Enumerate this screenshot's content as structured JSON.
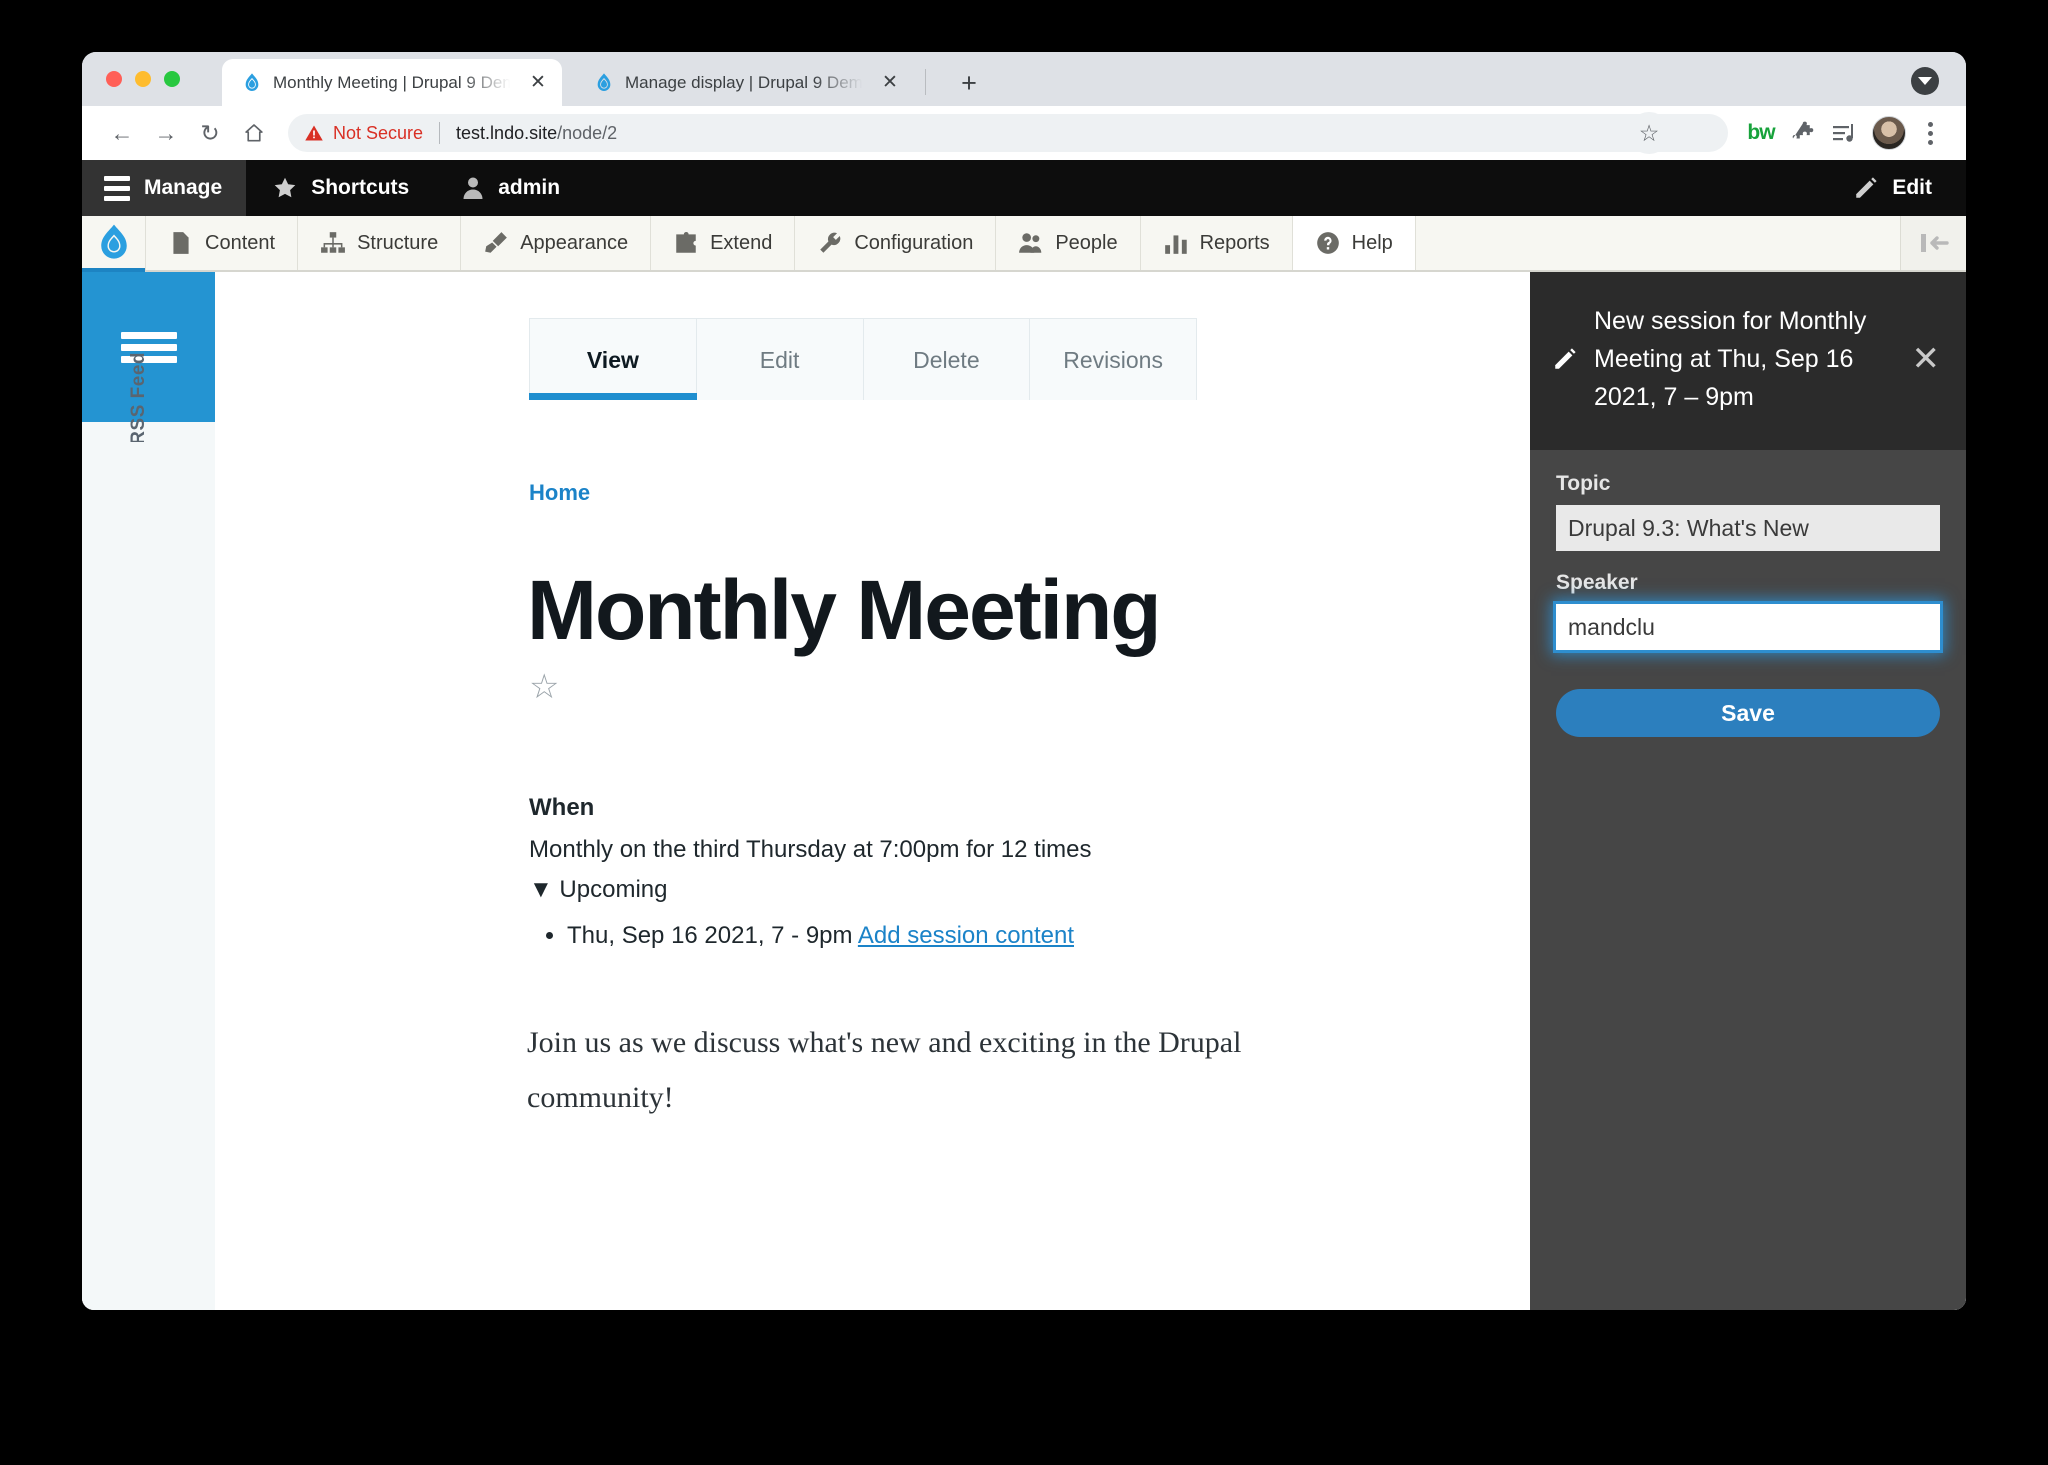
{
  "browser": {
    "tabs": [
      {
        "title": "Monthly Meeting | Drupal 9 Dem",
        "icon": "drupal-drop-icon",
        "active": true,
        "close_label": "✕"
      },
      {
        "title": "Manage display | Drupal 9 Dem",
        "icon": "drupal-drop-icon",
        "active": false,
        "close_label": "✕"
      }
    ],
    "new_tab_label": "+",
    "nav": {
      "back": "←",
      "forward": "→",
      "reload": "↻",
      "home": "⌂"
    },
    "omnibox": {
      "security_label": "Not Secure",
      "security_icon": "warning-triangle-icon",
      "url_host": "test.lndo.site",
      "url_path": "/node/2"
    },
    "extensions": [
      {
        "name": "bookmark-star-icon",
        "label": "☆"
      },
      {
        "name": "bw-extension-icon",
        "label": "bw"
      },
      {
        "name": "puzzle-extensions-icon",
        "label": ""
      },
      {
        "name": "media-playlist-icon",
        "label": ""
      }
    ],
    "menu_label": "⋮"
  },
  "admin_bar": {
    "manage_label": "Manage",
    "shortcuts_label": "Shortcuts",
    "account_label": "admin",
    "edit_label": "Edit"
  },
  "menu_bar": {
    "items": [
      {
        "label": "Content",
        "icon": "file-icon",
        "highlight": false
      },
      {
        "label": "Structure",
        "icon": "sitemap-icon",
        "highlight": false
      },
      {
        "label": "Appearance",
        "icon": "paintbrush-icon",
        "highlight": false
      },
      {
        "label": "Extend",
        "icon": "puzzle-icon",
        "highlight": false
      },
      {
        "label": "Configuration",
        "icon": "wrench-icon",
        "highlight": false
      },
      {
        "label": "People",
        "icon": "people-icon",
        "highlight": false
      },
      {
        "label": "Reports",
        "icon": "bar-chart-icon",
        "highlight": true
      },
      {
        "label": "Help",
        "icon": "question-circle-icon",
        "highlight": true
      }
    ]
  },
  "left_rail": {
    "rss_label": "RSS Feed"
  },
  "node": {
    "tabs": [
      {
        "label": "View",
        "active": true
      },
      {
        "label": "Edit",
        "active": false
      },
      {
        "label": "Delete",
        "active": false
      },
      {
        "label": "Revisions",
        "active": false
      }
    ],
    "breadcrumb": "Home",
    "title": "Monthly Meeting",
    "flag_star": "☆",
    "when_heading": "When",
    "recurrence": "Monthly on the third Thursday at 7:00pm for 12 times",
    "upcoming_label": "▼ Upcoming",
    "upcoming_items": [
      {
        "date": "Thu, Sep 16 2021, 7 - 9pm",
        "link": "Add session content"
      }
    ],
    "body": "Join us as we discuss what's new and exciting in the Drupal community!"
  },
  "settings_tray": {
    "title": "New session for Monthly Meeting at Thu, Sep 16 2021, 7 – 9pm",
    "close_label": "✕",
    "topic_label": "Topic",
    "topic_value": "Drupal 9.3: What's New",
    "speaker_label": "Speaker",
    "speaker_value": "mandclu",
    "save_label": "Save"
  },
  "colors": {
    "drupal_blue": "#2494d2",
    "link_blue": "#1b83c8",
    "tray_bg": "#464646",
    "tray_header_bg": "#2b2b2b",
    "save_button": "#2c7fbe",
    "not_secure_red": "#d93025"
  }
}
